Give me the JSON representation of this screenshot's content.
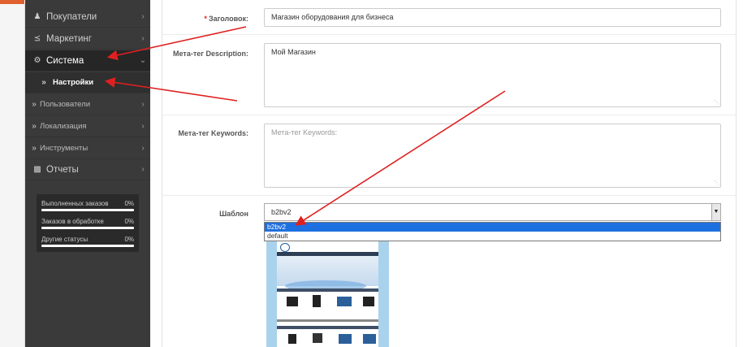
{
  "sidebar": {
    "items": [
      {
        "label": "Покупатели",
        "icon": "user-icon"
      },
      {
        "label": "Маркетинг",
        "icon": "share-icon"
      },
      {
        "label": "Система",
        "icon": "gear-icon"
      },
      {
        "label": "Настройки",
        "icon": "double-chevron-right-icon"
      },
      {
        "label": "Пользователи",
        "icon": "double-chevron-right-icon"
      },
      {
        "label": "Локализация",
        "icon": "double-chevron-right-icon"
      },
      {
        "label": "Инструменты",
        "icon": "double-chevron-right-icon"
      },
      {
        "label": "Отчеты",
        "icon": "bar-chart-icon"
      }
    ],
    "stats": [
      {
        "label": "Выполненных заказов",
        "value": "0%"
      },
      {
        "label": "Заказов в обработке",
        "value": "0%"
      },
      {
        "label": "Другие статусы",
        "value": "0%"
      }
    ]
  },
  "form": {
    "title_label": "Заголовок:",
    "title_value": "Магазин оборудования для бизнеса",
    "description_label": "Мета-тег Description:",
    "description_value": "Мой Магазин",
    "keywords_label": "Мета-тег Keywords:",
    "keywords_placeholder": "Мета-тег Keywords:",
    "template_label": "Шаблон",
    "template_value": "b2bv2",
    "template_options": [
      "b2bv2",
      "default"
    ]
  },
  "colors": {
    "sidebar_bg": "#3a3a3a",
    "selected_option": "#1e6fe0",
    "annotation_arrow": "#e02020"
  }
}
